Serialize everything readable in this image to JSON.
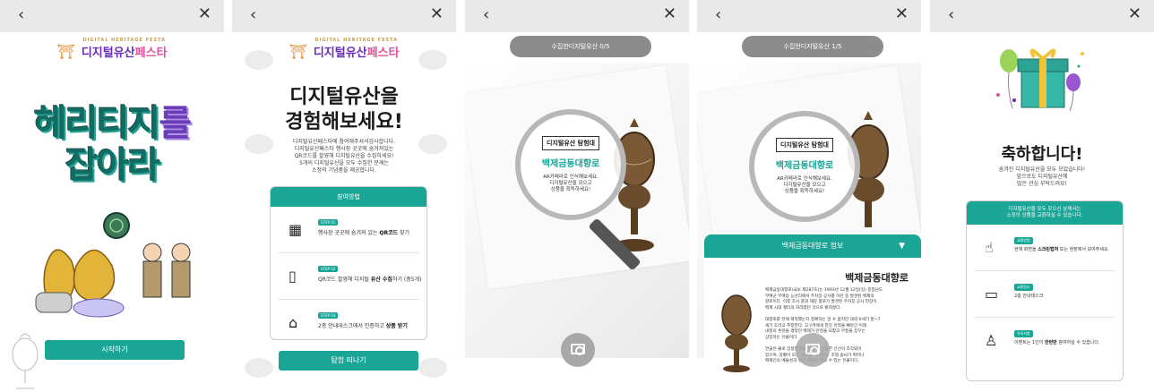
{
  "nav": {
    "back": "‹",
    "close": "✕"
  },
  "logo": {
    "sub": "DIGITAL HERITAGE FESTA",
    "main_a": "디지털유산",
    "main_b": "페스타"
  },
  "screen1": {
    "title_a": "헤리티지",
    "title_b": "를",
    "title_c": "잡아라",
    "start_button": "시작하기"
  },
  "screen2": {
    "heading_1": "디지털유산을",
    "heading_2": "경험해보세요!",
    "desc": [
      "디지털유산페스타에 참여해주셔서감사합니다.",
      "디지털유산페스타 행사장 곳곳에 숨겨져있는",
      "QR코드를 촬영해 디지털유산을 수집하세요!",
      "5개의 디지털유산을 모두 수집한 분께는",
      "소정의 기념품을 제공합니다."
    ],
    "card_title": "참여방법",
    "steps": [
      {
        "badge": "STEP 01",
        "text_a": "행사장 곳곳에 숨겨져 있는 ",
        "text_b": "QR코드",
        "text_c": " 찾기"
      },
      {
        "badge": "STEP 02",
        "text_a": "QR코드 촬영해 디지털 ",
        "text_b": "유산 수집",
        "text_c": "하기 (총5개)"
      },
      {
        "badge": "STEP 03",
        "text_a": "2층 안내데스크에서 인증하고 ",
        "text_b": "상품 받기",
        "text_c": ""
      }
    ],
    "button": "탐험 떠나기"
  },
  "screen3": {
    "counter": "수집한디지털유산 0/5",
    "lens_tag": "디지털유산 탐험대",
    "lens_name": "백제금동대향로",
    "lens_desc": [
      "AR카메라로 인식해보세요.",
      "디지털유산을 모으고",
      "상품을 획득하세요!"
    ]
  },
  "screen4": {
    "counter": "수집한디지털유산 1/5",
    "lens_tag": "디지털유산 탐험대",
    "lens_name": "백제금동대향로",
    "lens_desc": [
      "AR카메라로 인식해보세요.",
      "디지털유산을 모으고",
      "상품을 획득하세요!"
    ],
    "panel_head": "백제금동대향로 정보",
    "panel_title": "백제금동대향로",
    "panel_body": [
      "백제금동대향로(국보 제287호)는 1993년 12월 12일(일) 충청남도",
      "부여군 부여읍 능산리에서 주차장 공사를 하던 중 발견된 백제의",
      "향로이다. 이후 조사 결과 해당 향로가 발견된 주차장 공사 현장이",
      "백제 시대 절터의 자리였던 것으로 밝혀졌다.",
      "",
      "대향로를 만에 제작했는지 정확하는 알 수 없지만 대략 6세기 말~7",
      "세기 초라고 추정한다. 고구려에게 한강 유역을 빼앗긴 이래",
      "내정의 혼란을 겪었던 백제가 안정을 되찾고 부흥을 꿈꾸는",
      "상징하는 유물이다.",
      "",
      "연꽃은 불로 장생한 향로 상부와 장엄한 신선이 조각되어",
      "있으며, 봉황이 모든 세계를 보여준다. 조형 솜씨가 뛰어나",
      "백제인의 예술성과 정신 세계를 엿볼 수 있는 유물이다."
    ]
  },
  "screen5": {
    "heading": "축하합니다!",
    "desc": [
      "숨겨진 디지털유산을 모두 모았습니다!",
      "앞으로도 디지털유산에",
      "많은 관심 부탁드려요!"
    ],
    "card_title_1": "디지털유산을 모두 모으신 분께서는",
    "card_title_2": "소정의 상품을 교환하실 수 있습니다.",
    "steps": [
      {
        "badge": "교환방법",
        "text_a": "현재 화면을 ",
        "text_b": "스크린캡처",
        "text_c": " 또는 현장에서 보여주세요."
      },
      {
        "badge": "교환장소",
        "text_a": "2층 안내데스크",
        "text_b": "",
        "text_c": ""
      },
      {
        "badge": "유의사항",
        "text_a": "이벤트는 1인이 ",
        "text_b": "한번만",
        "text_c": " 참여하실 수 있습니다."
      }
    ]
  },
  "colors": {
    "teal": "#1aa596",
    "purple": "#6a2bb8",
    "pink": "#e0529c"
  }
}
